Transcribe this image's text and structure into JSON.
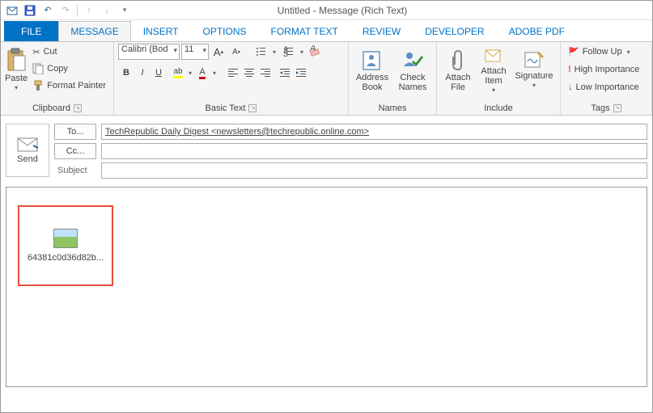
{
  "window": {
    "title": "Untitled - Message (Rich Text)"
  },
  "tabs": {
    "file": "FILE",
    "message": "MESSAGE",
    "insert": "INSERT",
    "options": "OPTIONS",
    "format_text": "FORMAT TEXT",
    "review": "REVIEW",
    "developer": "DEVELOPER",
    "adobe_pdf": "ADOBE PDF"
  },
  "ribbon": {
    "clipboard": {
      "label": "Clipboard",
      "paste": "Paste",
      "cut": "Cut",
      "copy": "Copy",
      "format_painter": "Format Painter"
    },
    "basic_text": {
      "label": "Basic Text",
      "font_name": "Calibri (Bod",
      "font_size": "11"
    },
    "names": {
      "label": "Names",
      "address_book": "Address\nBook",
      "check_names": "Check\nNames"
    },
    "include": {
      "label": "Include",
      "attach_file": "Attach\nFile",
      "attach_item": "Attach\nItem",
      "signature": "Signature"
    },
    "tags": {
      "label": "Tags",
      "follow_up": "Follow Up",
      "high": "High Importance",
      "low": "Low Importance"
    }
  },
  "compose": {
    "send": "Send",
    "to_label": "To...",
    "to_value": "TechRepublic Daily Digest <newsletters@techrepublic.online.com>",
    "cc_label": "Cc...",
    "cc_value": "",
    "subject_label": "Subject",
    "subject_value": ""
  },
  "attachment": {
    "filename": "64381c0d36d82b..."
  }
}
